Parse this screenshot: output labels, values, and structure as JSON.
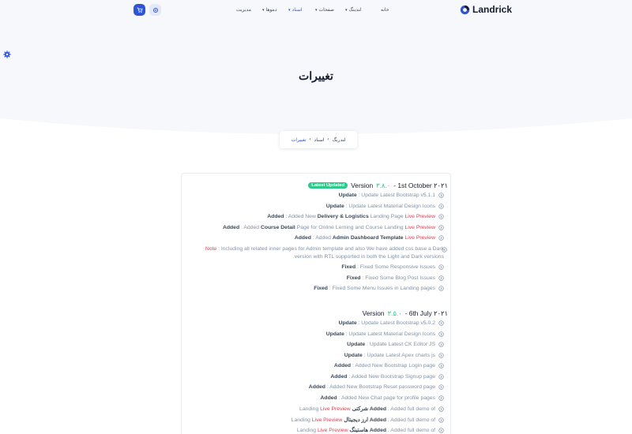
{
  "brand": {
    "name": "Landrick"
  },
  "nav": {
    "home": "خانه",
    "landings": "لندینگ",
    "pages": "صفحات",
    "docs": "اسناد",
    "demos": "دموها",
    "admin": "مدیریت"
  },
  "page": {
    "title": "تغییرات"
  },
  "breadcrumb": [
    "لندریگ",
    "اسناد",
    "تغییرات"
  ],
  "colors": {
    "primary": "#2f55d4",
    "success": "#2eca8b",
    "danger": "#e43f52"
  },
  "icons": {
    "cart": "shopping-cart-icon",
    "settings": "gear-icon",
    "item": "arrow-circle-icon"
  },
  "v1": {
    "label": "Version",
    "num": "۳.۸.۰",
    "date": "- 1st October ۲۰۲۱",
    "badge": "Latest Updated",
    "l1_bold": "Update",
    "l1_text": ": Update Latest Bootstrap v5.1.1",
    "l2_bold": "Update",
    "l2_text": ": Update Latest Material Design Icons",
    "l3_bold": "Added",
    "l3_a": ": Added New ",
    "l3_b": "Delivery & Logistics",
    "l3_c": " Landing Page ",
    "l3_red": "Live Preview",
    "l4_bold": "Added",
    "l4_a": ": Added ",
    "l4_b": "Course Detail",
    "l4_c": " Page for Online Lerning and Course Landing ",
    "l4_red": "Live Preview",
    "l5_bold": "Added",
    "l5_a": ": Added ",
    "l5_b": "Admin Dashboard Template",
    "l5_red": "Live Preview",
    "note_red": "Note",
    "note_text": ": Including all related inner pages for Admin template and also We have added css base a Dark",
    "note_text2": ".version with RTL supported in both the Light and Dark versions",
    "l7_bold": "Fixed",
    "l7_text": ": Fixed Some Responsive Issues",
    "l8_bold": "Fixed",
    "l8_text": ": Fixed Some Blog Post Issues",
    "l9_bold": "Fixed",
    "l9_text": ": Fixed Some Menu Issues in Landing pages"
  },
  "v2": {
    "label": "Version",
    "num": "۳.۵.۰",
    "date": "- 6th July ۲۰۲۱",
    "l1_bold": "Update",
    "l1_text": ": Update Latest Bootstrap v5.0.2",
    "l2_bold": "Update",
    "l2_text": ": Update Latest Material Design Icons",
    "l3_bold": "Update",
    "l3_text": ": Update Latest CK Editor JS",
    "l4_bold": "Update",
    "l4_text": ": Update Latest Apex charts js",
    "l5_bold": "Added",
    "l5_text": ": Added New Bootstrap Login page",
    "l6_bold": "Added",
    "l6_text": ": Added New Bootstrap Signup page",
    "l7_bold": "Added",
    "l7_text": ": Added New Bootstrap Reset password page",
    "l8_bold": "Added",
    "l8_text": ": Added New Chat page for profile pages",
    "l9_bold": "Added",
    "l9_a": ": Added full demo of ",
    "l9_b": "شرکتی",
    "l9_red": "Live Preview",
    "l9_c": "Landing",
    "l10_bold": "Added",
    "l10_a": ": Added full demo of ",
    "l10_b": "ارز دیجیتال",
    "l10_red": "Live Preview",
    "l10_c": "Landing",
    "l11_bold": "Added",
    "l11_a": ": Added full demo of ",
    "l11_b": "هاستینگ",
    "l11_red": "Live Preview",
    "l11_c": "Landing"
  }
}
